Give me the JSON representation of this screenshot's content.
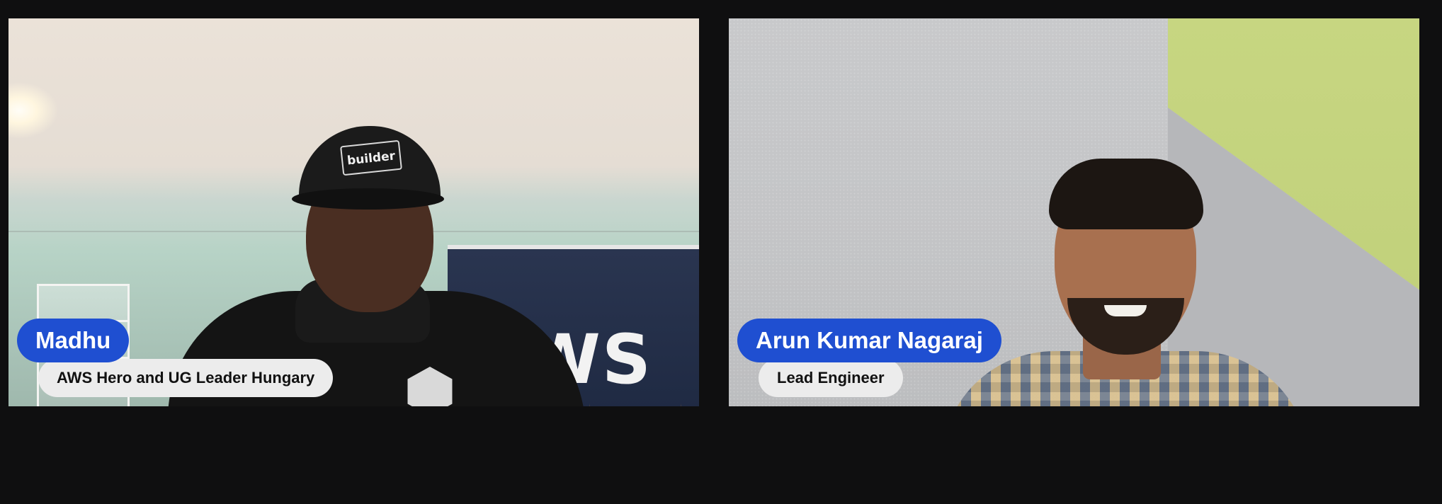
{
  "participants": [
    {
      "name": "Madhu",
      "title": "AWS Hero and UG Leader Hungary",
      "cap_text": "builder",
      "banner_text": "WS"
    },
    {
      "name": "Arun Kumar Nagaraj",
      "title": "Lead Engineer"
    }
  ],
  "colors": {
    "background": "#0f0f10",
    "name_pill": "#1f4fd1",
    "title_pill": "#ececec"
  }
}
